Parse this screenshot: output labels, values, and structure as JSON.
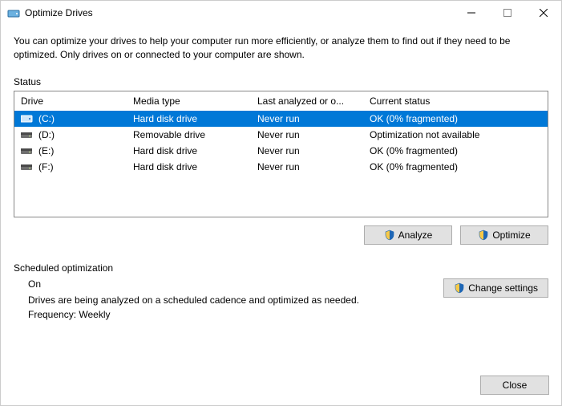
{
  "window": {
    "title": "Optimize Drives"
  },
  "description": "You can optimize your drives to help your computer run more efficiently, or analyze them to find out if they need to be optimized. Only drives on or connected to your computer are shown.",
  "status_label": "Status",
  "table": {
    "headers": {
      "drive": "Drive",
      "media": "Media type",
      "last": "Last analyzed or o...",
      "status": "Current status"
    },
    "rows": [
      {
        "drive": "(C:)",
        "media": "Hard disk drive",
        "last": "Never run",
        "status": "OK (0% fragmented)",
        "selected": true,
        "icon": "hdd"
      },
      {
        "drive": "(D:)",
        "media": "Removable drive",
        "last": "Never run",
        "status": "Optimization not available",
        "selected": false,
        "icon": "removable"
      },
      {
        "drive": "(E:)",
        "media": "Hard disk drive",
        "last": "Never run",
        "status": "OK (0% fragmented)",
        "selected": false,
        "icon": "hdd"
      },
      {
        "drive": "(F:)",
        "media": "Hard disk drive",
        "last": "Never run",
        "status": "OK (0% fragmented)",
        "selected": false,
        "icon": "hdd"
      }
    ]
  },
  "buttons": {
    "analyze": "Analyze",
    "optimize": "Optimize",
    "change_settings": "Change settings",
    "close": "Close"
  },
  "scheduled": {
    "label": "Scheduled optimization",
    "state": "On",
    "desc": "Drives are being analyzed on a scheduled cadence and optimized as needed.",
    "frequency": "Frequency: Weekly"
  }
}
